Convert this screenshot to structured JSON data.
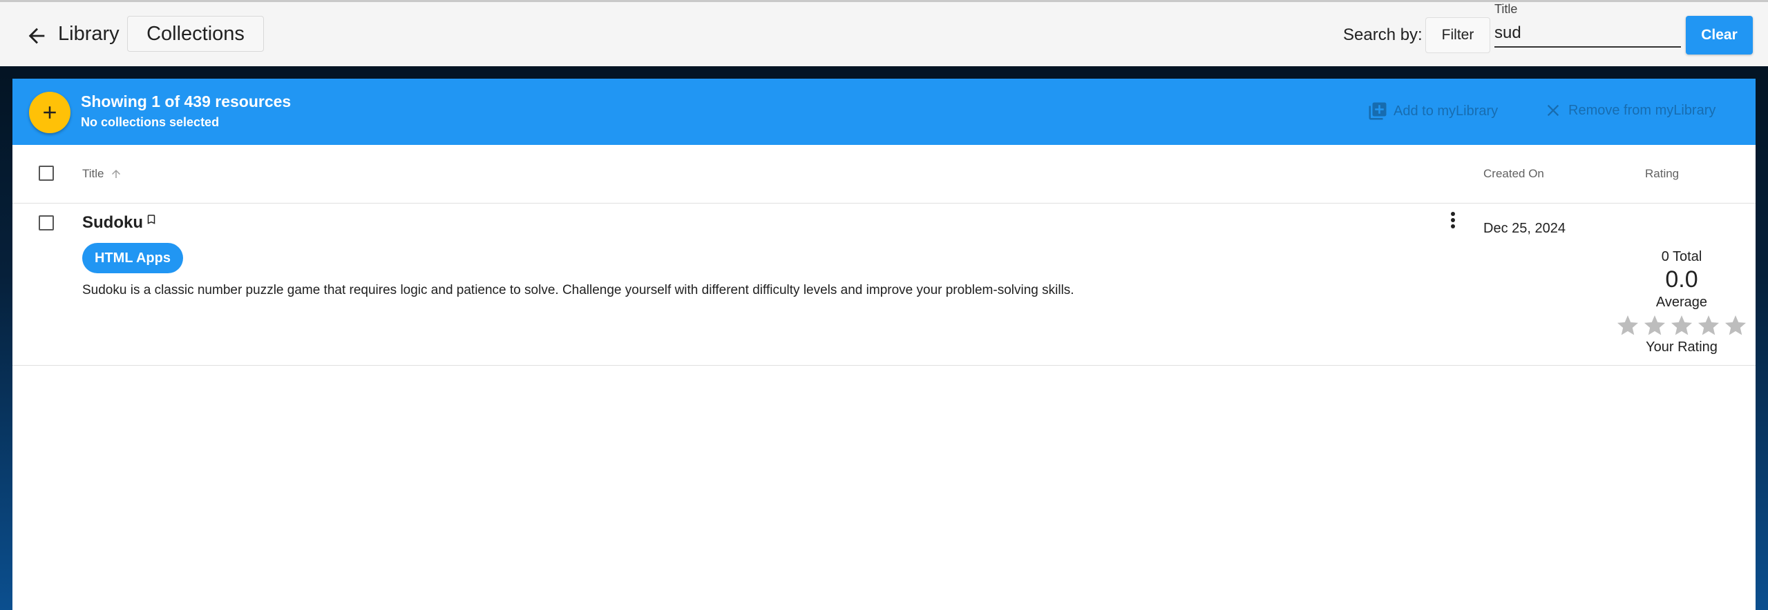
{
  "header": {
    "title": "Library",
    "collections_label": "Collections",
    "search_by_label": "Search by:",
    "filter_label": "Filter",
    "search_field_label": "Title",
    "search_value": "sud",
    "clear_label": "Clear"
  },
  "toolbar": {
    "showing_text": "Showing 1 of 439 resources",
    "collections_text": "No collections selected",
    "add_label": "Add to myLibrary",
    "remove_label": "Remove from myLibrary"
  },
  "table": {
    "columns": {
      "title": "Title",
      "created": "Created On",
      "rating": "Rating"
    },
    "rows": [
      {
        "title": "Sudoku",
        "tag": "HTML Apps",
        "description": "Sudoku is a classic number puzzle game that requires logic and patience to solve. Challenge yourself with different difficulty levels and improve your problem-solving skills.",
        "created_on": "Dec 25, 2024",
        "rating_total": "0 Total",
        "rating_average": "0.0",
        "average_label": "Average",
        "your_rating_label": "Your Rating",
        "your_rating_stars": 0,
        "max_stars": 5
      }
    ]
  },
  "colors": {
    "primary": "#2196f3",
    "fab": "#ffc107",
    "star_empty": "#bdbdbd"
  }
}
